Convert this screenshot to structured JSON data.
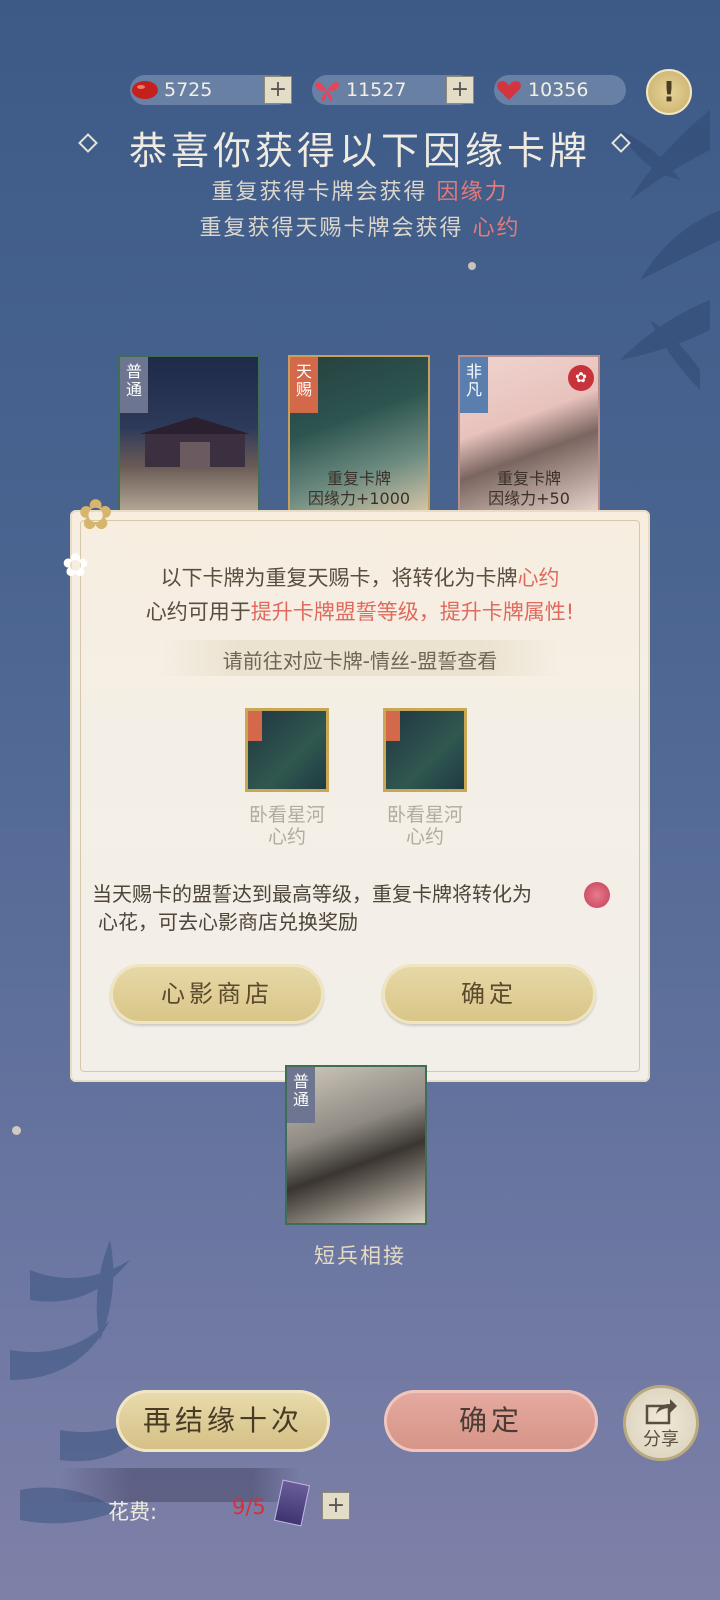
{
  "currency": [
    {
      "icon": "red-bean-icon",
      "value": "5725"
    },
    {
      "icon": "butterfly-icon",
      "value": "11527"
    },
    {
      "icon": "heart-icon",
      "value": "10356"
    }
  ],
  "title": "恭喜你获得以下因缘卡牌",
  "subtitle_1": {
    "text": "重复获得卡牌会获得",
    "highlight": "因缘力"
  },
  "subtitle_2": {
    "text": "重复获得天赐卡牌会获得",
    "highlight": "心约"
  },
  "cards": [
    {
      "tag": "普通",
      "repeat_line1": "",
      "repeat_line2": ""
    },
    {
      "tag": "天赐",
      "repeat_line1": "重复卡牌",
      "repeat_line2": "因缘力+1000"
    },
    {
      "tag": "非凡",
      "repeat_line1": "重复卡牌",
      "repeat_line2": "因缘力+50"
    }
  ],
  "dialog": {
    "line1_pre": "以下卡牌为重复天赐卡，将转化为卡牌",
    "line1_red": "心约",
    "line2_pre": "心约可用于",
    "line2_red": "提升卡牌盟誓等级，提升卡牌属性!",
    "hint": "请前往对应卡牌-情丝-盟誓查看",
    "items": [
      {
        "name": "卧看星河",
        "type": "心约"
      },
      {
        "name": "卧看星河",
        "type": "心约"
      }
    ],
    "note_line1": "当天赐卡的盟誓达到最高等级，重复卡牌将转化为",
    "note_line2": "心花，可去心影商店兑换奖励",
    "shop_button": "心影商店",
    "confirm_button": "确定"
  },
  "bottom_card": {
    "tag": "普通",
    "name": "短兵相接"
  },
  "bottom": {
    "again_button": "再结缘十次",
    "confirm_button": "确定",
    "share_label": "分享",
    "cost_label": "花费:",
    "cost_value": "9/5"
  }
}
